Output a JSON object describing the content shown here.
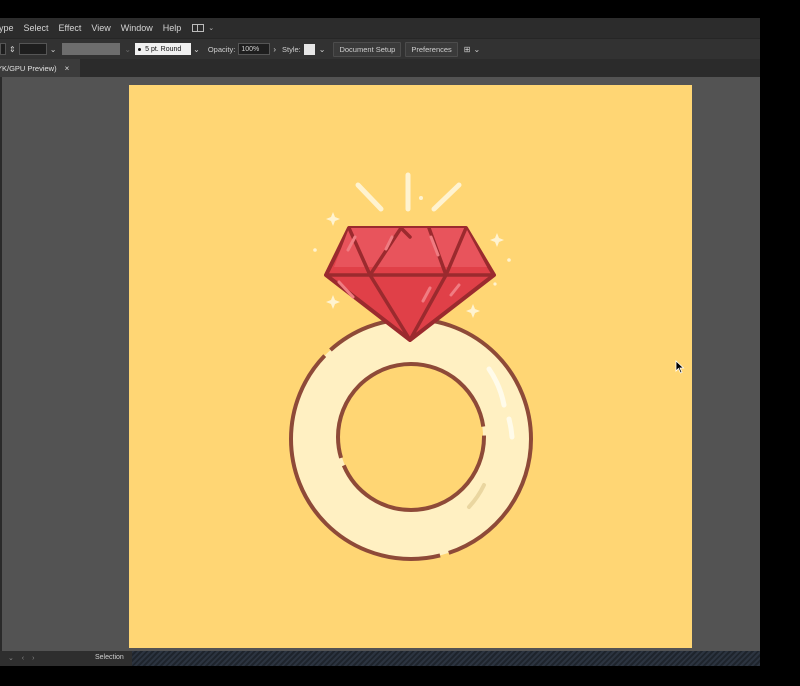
{
  "menubar": {
    "items": [
      "ype",
      "Select",
      "Effect",
      "View",
      "Window",
      "Help"
    ],
    "workspace_icon": "layout-grid-icon"
  },
  "controlbar": {
    "stroke_profile": "5 pt. Round",
    "opacity_label": "Opacity:",
    "opacity_value": "100%",
    "style_label": "Style:",
    "document_setup": "Document Setup",
    "preferences": "Preferences"
  },
  "tab": {
    "name": "YK/GPU Preview)",
    "close": "×"
  },
  "statusbar": {
    "tool": "Selection"
  },
  "colors": {
    "artboard_bg": "#FFD674",
    "gem_red": "#E04048",
    "gem_outline": "#9B2A2E",
    "ring_cream": "#FFF0C2",
    "ring_outline": "#8E4A38",
    "sparkle": "#FFF3D0"
  }
}
